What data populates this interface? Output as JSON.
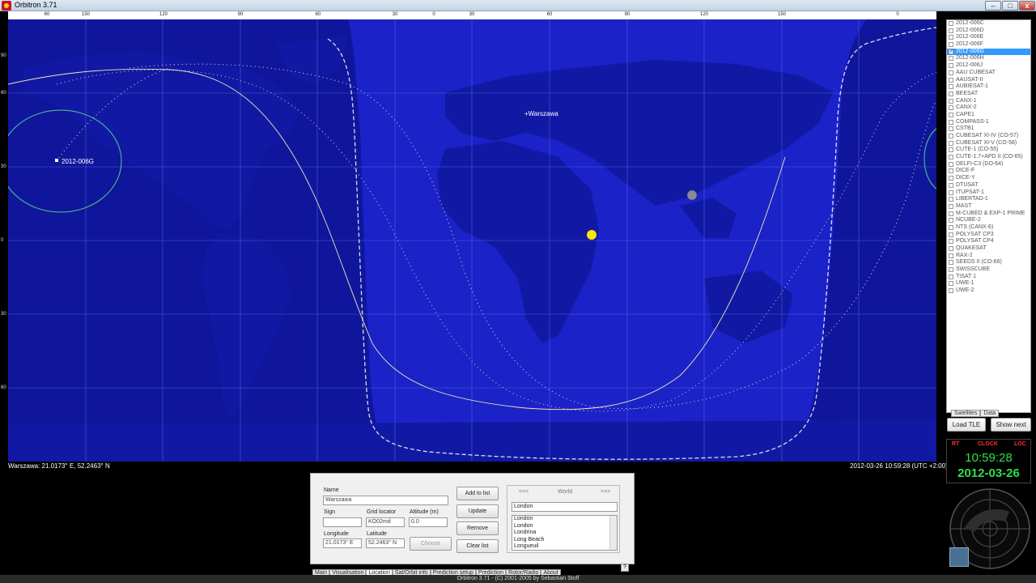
{
  "window": {
    "title": "Orbitron 3.71"
  },
  "top_scale": [
    "60",
    "150",
    "120",
    "90",
    "60",
    "30",
    "0",
    "30",
    "60",
    "90",
    "120",
    "150",
    "0"
  ],
  "left_scale": [
    "90",
    "60",
    "30",
    "0",
    "30",
    "60"
  ],
  "map": {
    "city_label": "+Warszawa",
    "sat_label": "2012-006G",
    "status_left": "Warszawa: 21.0173° E, 52.2463° N",
    "status_right": "2012-03-26 10:59:28 (UTC +2:00)"
  },
  "satellites": [
    {
      "name": "2012-006C",
      "checked": false,
      "selected": false
    },
    {
      "name": "2012-006D",
      "checked": false,
      "selected": false
    },
    {
      "name": "2012-006E",
      "checked": false,
      "selected": false
    },
    {
      "name": "2012-006F",
      "checked": false,
      "selected": false
    },
    {
      "name": "2012-006G",
      "checked": true,
      "selected": true
    },
    {
      "name": "2012-006H",
      "checked": false,
      "selected": false
    },
    {
      "name": "2012-006J",
      "checked": false,
      "selected": false
    },
    {
      "name": "AAU CUBESAT",
      "checked": false,
      "selected": false
    },
    {
      "name": "AAUSAT-II",
      "checked": false,
      "selected": false
    },
    {
      "name": "AUBIESAT-1",
      "checked": false,
      "selected": false
    },
    {
      "name": "BEESAT",
      "checked": false,
      "selected": false
    },
    {
      "name": "CANX-1",
      "checked": false,
      "selected": false
    },
    {
      "name": "CANX-2",
      "checked": false,
      "selected": false
    },
    {
      "name": "CAPE1",
      "checked": false,
      "selected": false
    },
    {
      "name": "COMPASS-1",
      "checked": false,
      "selected": false
    },
    {
      "name": "CSTB1",
      "checked": false,
      "selected": false
    },
    {
      "name": "CUBESAT XI-IV (CO-57)",
      "checked": false,
      "selected": false
    },
    {
      "name": "CUBESAT XI-V (CO-58)",
      "checked": false,
      "selected": false
    },
    {
      "name": "CUTE-1 (CO-55)",
      "checked": false,
      "selected": false
    },
    {
      "name": "CUTE-1.7+APD II (CO-65)",
      "checked": false,
      "selected": false
    },
    {
      "name": "DELFI-C3 (DO-64)",
      "checked": false,
      "selected": false
    },
    {
      "name": "DICE-F",
      "checked": false,
      "selected": false
    },
    {
      "name": "DICE-Y",
      "checked": false,
      "selected": false
    },
    {
      "name": "DTUSAT",
      "checked": false,
      "selected": false
    },
    {
      "name": "ITUPSAT-1",
      "checked": false,
      "selected": false
    },
    {
      "name": "LIBERTAD-1",
      "checked": false,
      "selected": false
    },
    {
      "name": "MAST",
      "checked": false,
      "selected": false
    },
    {
      "name": "M-CUBED & EXP-1 PRIME",
      "checked": false,
      "selected": false
    },
    {
      "name": "NCUBE-2",
      "checked": false,
      "selected": false
    },
    {
      "name": "NTS (CANX-6)",
      "checked": false,
      "selected": false
    },
    {
      "name": "POLYSAT CP3",
      "checked": false,
      "selected": false
    },
    {
      "name": "POLYSAT CP4",
      "checked": false,
      "selected": false
    },
    {
      "name": "QUAKESAT",
      "checked": false,
      "selected": false
    },
    {
      "name": "RAX-2",
      "checked": false,
      "selected": false
    },
    {
      "name": "SEEDS II (CO-66)",
      "checked": false,
      "selected": false
    },
    {
      "name": "SWISSCUBE",
      "checked": false,
      "selected": false
    },
    {
      "name": "TISAT 1",
      "checked": false,
      "selected": false
    },
    {
      "name": "UWE-1",
      "checked": false,
      "selected": false
    },
    {
      "name": "UWE-2",
      "checked": false,
      "selected": false
    }
  ],
  "sat_tabs": {
    "satellites": "Satellites",
    "data": "Data"
  },
  "buttons": {
    "load_tle": "Load TLE",
    "show_next": "Show next"
  },
  "clock": {
    "rt": "RT",
    "clock": "CLOCK",
    "loc": "LOC",
    "time": "10:59:28",
    "date": "2012-03-26"
  },
  "location": {
    "name_label": "Name",
    "name_value": "Warszawa",
    "sign_label": "Sign",
    "sign_value": "",
    "grid_label": "Grid locator",
    "grid_value": "KO02md",
    "alt_label": "Altitude (m)",
    "alt_value": "0.0",
    "lon_label": "Longitude",
    "lon_value": "21.0173° E",
    "lat_label": "Latitude",
    "lat_value": "52.2463° N",
    "add": "Add to list",
    "update": "Update",
    "remove": "Remove",
    "clear": "Clear list",
    "choose": "Choose",
    "prev": "<<<",
    "region": "World",
    "next": ">>>",
    "search_value": "London",
    "cities": [
      "London",
      "London",
      "Londrina",
      "Long Beach",
      "Longueuil"
    ]
  },
  "tabs": [
    "Main",
    "Visualisation",
    "Location",
    "Sat/Orbit info",
    "Prediction setup",
    "Prediction",
    "Rotor/Radio",
    "About"
  ],
  "active_tab": "Location",
  "help": "?",
  "footer": "Orbitron 3.71 - (C) 2001-2005 by Sebastian Stoff",
  "colors": {
    "ocean": "#1b22c8",
    "land": "#1018a0",
    "night": "#0d1388",
    "orbit": "#e8e8c0",
    "footprint": "#4fd08a",
    "clock_green": "#2fe04a"
  }
}
